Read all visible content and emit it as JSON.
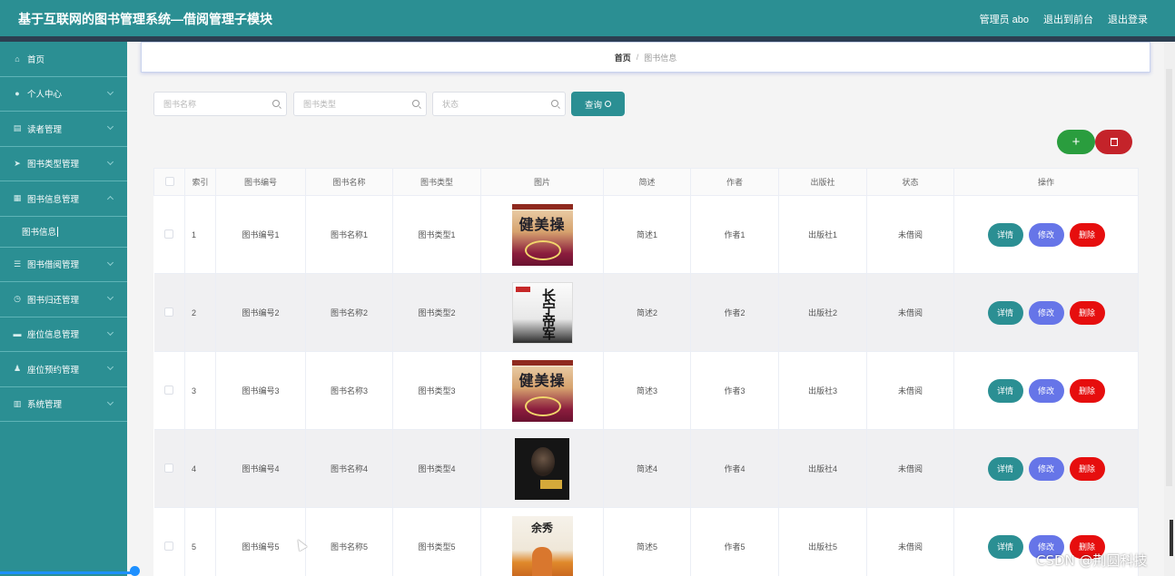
{
  "header": {
    "title": "基于互联网的图书管理系统—借阅管理子模块",
    "admin_label": "管理员 abo",
    "front_label": "退出到前台",
    "logout_label": "退出登录"
  },
  "sidebar": {
    "items": [
      {
        "label": "首页",
        "icon": "home-icon"
      },
      {
        "label": "个人中心",
        "icon": "user-icon"
      },
      {
        "label": "读者管理",
        "icon": "reader-icon"
      },
      {
        "label": "图书类型管理",
        "icon": "send-icon"
      },
      {
        "label": "图书信息管理",
        "icon": "grid-icon"
      },
      {
        "label": "图书借阅管理",
        "icon": "list-icon"
      },
      {
        "label": "图书归还管理",
        "icon": "clock-icon"
      },
      {
        "label": "座位信息管理",
        "icon": "seat-icon"
      },
      {
        "label": "座位预约管理",
        "icon": "person-icon"
      },
      {
        "label": "系统管理",
        "icon": "system-icon"
      }
    ],
    "sub_item": "图书信息"
  },
  "breadcrumb": {
    "home": "首页",
    "separator": "/",
    "current": "图书信息"
  },
  "search": {
    "name_placeholder": "图书名称",
    "type_placeholder": "图书类型",
    "status_placeholder": "状态",
    "query_label": "查询"
  },
  "actions": {
    "add_label": "+"
  },
  "table": {
    "headers": [
      "索引",
      "图书编号",
      "图书名称",
      "图书类型",
      "图片",
      "简述",
      "作者",
      "出版社",
      "状态",
      "操作"
    ],
    "rows": [
      {
        "index": "1",
        "code": "图书编号1",
        "name": "图书名称1",
        "type": "图书类型1",
        "cover": "健美操",
        "summary": "简述1",
        "author": "作者1",
        "publisher": "出版社1",
        "status": "未借阅"
      },
      {
        "index": "2",
        "code": "图书编号2",
        "name": "图书名称2",
        "type": "图书类型2",
        "cover": "长宁帝军",
        "summary": "简述2",
        "author": "作者2",
        "publisher": "出版社2",
        "status": "未借阅"
      },
      {
        "index": "3",
        "code": "图书编号3",
        "name": "图书名称3",
        "type": "图书类型3",
        "cover": "健美操",
        "summary": "简述3",
        "author": "作者3",
        "publisher": "出版社3",
        "status": "未借阅"
      },
      {
        "index": "4",
        "code": "图书编号4",
        "name": "图书名称4",
        "type": "图书类型4",
        "cover": "",
        "summary": "简述4",
        "author": "作者4",
        "publisher": "出版社4",
        "status": "未借阅"
      },
      {
        "index": "5",
        "code": "图书编号5",
        "name": "图书名称5",
        "type": "图书类型5",
        "cover": "余秀",
        "summary": "简述5",
        "author": "作者5",
        "publisher": "出版社5",
        "status": "未借阅"
      }
    ],
    "op_detail": "详情",
    "op_edit": "修改",
    "op_delete": "删除"
  },
  "watermark": "CSDN @荆圆科技",
  "colors": {
    "primary": "#2b8f93",
    "add": "#2a9d3e",
    "danger": "#e60e0e",
    "edit": "#6675e8"
  }
}
